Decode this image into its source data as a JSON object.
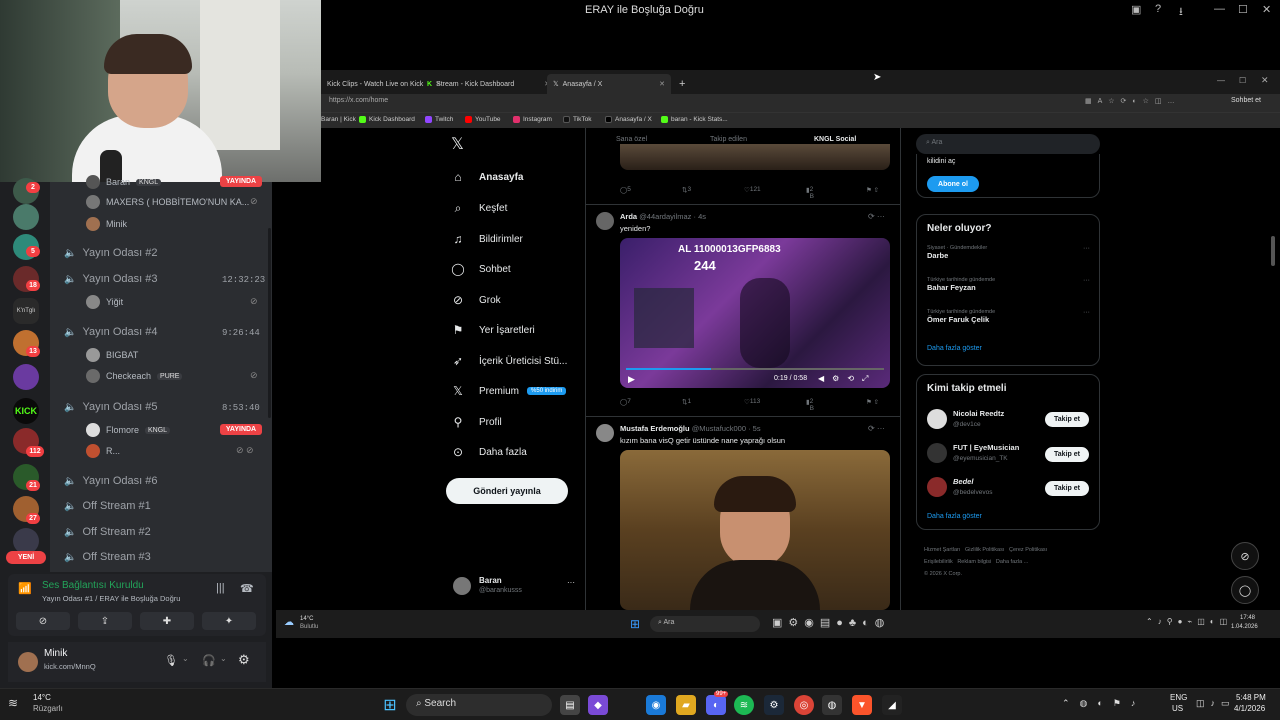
{
  "window": {
    "title": "ERAY ile Boşluğa Doğru"
  },
  "discord": {
    "guild_badges": [
      "2",
      "5",
      "18",
      "13",
      "112",
      "21",
      "27"
    ],
    "guild_label_kntgl": "K'nTglı",
    "new_label": "YENİ",
    "members_top": [
      {
        "name": "Baran",
        "tag": "KNGL",
        "live": "YAYINDA"
      },
      {
        "name": "MAXERS ( HOBBİTEMO'NUN KA..."
      },
      {
        "name": "Minik"
      }
    ],
    "channels": [
      {
        "name": "Yayın Odası #2",
        "timer": ""
      },
      {
        "name": "Yayın Odası #3",
        "timer": "12:32:23"
      },
      {
        "name": "Yayın Odası #4",
        "timer": "9:26:44"
      },
      {
        "name": "Yayın Odası #5",
        "timer": "8:53:40"
      },
      {
        "name": "Yayın Odası #6"
      },
      {
        "name": "Off Stream #1"
      },
      {
        "name": "Off Stream #2"
      },
      {
        "name": "Off Stream #3"
      }
    ],
    "members_3": [
      "Yiğit"
    ],
    "members_4": [
      {
        "name": "BIGBAT"
      },
      {
        "name": "Checkeach",
        "tag": "PURE"
      }
    ],
    "members_5": [
      {
        "name": "Flomore",
        "tag": "KNGL",
        "live": "YAYINDA"
      },
      {
        "name": "R..."
      }
    ],
    "voice": {
      "status": "Ses Bağlantısı Kuruldu",
      "room": "Yayın Odası #1 / ERAY ile Boşluğa Doğru"
    },
    "user": {
      "name": "Minik",
      "status": "kick.com/MnnQ"
    }
  },
  "browser": {
    "tabs": [
      "Kick Clips - Watch Live on Kick",
      "Stream - Kick Dashboard",
      "Anasayfa / X"
    ],
    "url": "https://x.com/home",
    "ask_label": "Sohbet et",
    "bookmarks": [
      "Baran | Kick",
      "Kick Dashboard",
      "Twitch",
      "YouTube",
      "Instagram",
      "TikTok",
      "Anasayfa / X",
      "baran - Kick Stats..."
    ]
  },
  "x": {
    "nav": [
      "Anasayfa",
      "Keşfet",
      "Bildirimler",
      "Sohbet",
      "Grok",
      "Yer İşaretleri",
      "İçerik Üreticisi Stü...",
      "Premium",
      "Profil",
      "Daha fazla"
    ],
    "premium_badge": "%50 indirim",
    "post_button": "Gönderi yayınla",
    "account": {
      "name": "Baran",
      "handle": "@barankusss"
    },
    "feed_tabs": [
      "Sana özel",
      "Takip edilen",
      "KNGL Social"
    ],
    "tweet0_stats": {
      "replies": "5",
      "retweets": "3",
      "likes": "121",
      "views": "2 B"
    },
    "tweet1": {
      "name": "Arda",
      "handle": "@44ardayilmaz · 4s",
      "text": "yeniden?",
      "overlay": "AL 11000013GFP6883",
      "overlay_num": "244",
      "time": "0:19 / 0:58",
      "replies": "7",
      "retweets": "1",
      "likes": "113",
      "views": "2 B"
    },
    "tweet2": {
      "name": "Mustafa Erdemoğlu",
      "handle": "@Mustafuck000 · 5s",
      "text": "kızım bana visQ getir üstünde nane yaprağı olsun"
    },
    "search_placeholder": "Ara",
    "premium_card": {
      "text": "kilidini aç",
      "button": "Abone ol"
    },
    "trends_title": "Neler oluyor?",
    "trends": [
      {
        "cat": "Siyaset · Gündemdekiler",
        "name": "Darbe"
      },
      {
        "cat": "Türkiye tarihinde gündemde",
        "name": "Bahar Feyzan"
      },
      {
        "cat": "Türkiye tarihinde gündemde",
        "name": "Ömer Faruk Çelik"
      }
    ],
    "trends_more": "Daha fazla göster",
    "follow_title": "Kimi takip etmeli",
    "follow": [
      {
        "name": "Nicolai Reedtz",
        "handle": "@dev1ce",
        "button": "Takip et"
      },
      {
        "name": "FUT | EyeMusician",
        "handle": "@eyemusician_TK",
        "button": "Takip et"
      },
      {
        "name": "Bedel",
        "handle": "@bedelvevos",
        "button": "Takip et"
      }
    ],
    "follow_more": "Daha fazla göster",
    "footer": [
      "Hizmet Şartları",
      "Gizlilik Politikası",
      "Çerez Politikası",
      "Erişilebilirlik",
      "Reklam bilgisi",
      "Daha fazla ...",
      "© 2026 X Corp."
    ]
  },
  "inner_taskbar": {
    "weather": "14°C",
    "weather_desc": "Bulutlu",
    "search": "Ara",
    "time": "17:48",
    "date": "1.04.2026"
  },
  "taskbar": {
    "weather": "14°C",
    "weather_desc": "Rüzgarlı",
    "search": "Search",
    "lang": "ENG",
    "region": "US",
    "time": "5:48 PM",
    "date": "4/1/2026",
    "discord_badge": "99+"
  }
}
